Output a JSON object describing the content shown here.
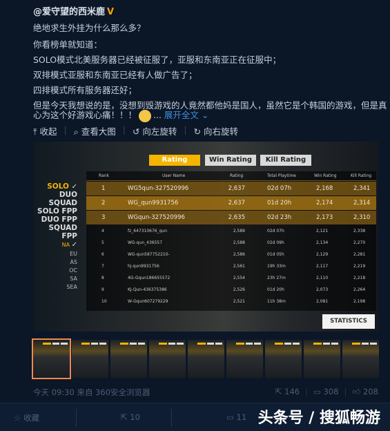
{
  "post": {
    "author": "@爱守望的西米鹿",
    "verified_badge": "V",
    "lines": [
      "绝地求生外挂为什么那么多？",
      "你看榜单就知道：",
      "SOLO模式北美服务器已经被征服了，亚服和东南亚正在征服中；",
      "双排模式亚服和东南亚已经有人做广告了；",
      "四排模式所有服务器还好；",
      "但是今天我想说的是，没想到毁游戏的人竟然都他妈是国人，虽然它是个韩国的游戏，但是真",
      "心为这个好游戏心痛！！！"
    ],
    "ellipsis": "...",
    "expand": "展开全文 ⌄",
    "actions": {
      "collapse": "⤒ 收起",
      "view_large": "⌕ 查看大图",
      "rotate_left": "↺ 向左旋转",
      "rotate_right": "↻ 向右旋转"
    }
  },
  "game": {
    "tabs": [
      "Rating",
      "Win Rating",
      "Kill Rating"
    ],
    "active_tab": 0,
    "modes": [
      "SOLO",
      "DUO",
      "SQUAD",
      "SOLO FPP",
      "DUO FPP",
      "SQUAD FPP"
    ],
    "regions": [
      "NA",
      "EU",
      "AS",
      "OC",
      "SA",
      "SEA"
    ],
    "check": "✓",
    "columns": [
      "Rank",
      "User Name",
      "Rating",
      "Total Playtime",
      "Win Rating",
      "Kill Rating"
    ],
    "rows": [
      [
        "1",
        "WG5qun-327520996",
        "2,637",
        "02d 07h",
        "2,168",
        "2,341"
      ],
      [
        "2",
        "WG_qun9931756",
        "2,637",
        "01d 20h",
        "2,174",
        "2,314"
      ],
      [
        "3",
        "WGqun-327520996",
        "2,635",
        "02d 23h",
        "2,173",
        "2,310"
      ],
      [
        "4",
        "fz_647310676_qun",
        "2,589",
        "02d 07h",
        "2,121",
        "2,338"
      ],
      [
        "5",
        "WG-qun_436557",
        "2,588",
        "02d 09h",
        "2,134",
        "2,270"
      ],
      [
        "6",
        "WG-qun587752210-",
        "2,586",
        "01d 05h",
        "2,129",
        "2,281"
      ],
      [
        "7",
        "hj-qun9931756",
        "2,561",
        "19h 33m",
        "2,117",
        "2,219"
      ],
      [
        "8",
        "4G-Gqun186655572",
        "2,554",
        "23h 27m",
        "2,110",
        "2,218"
      ],
      [
        "9",
        "KJ-Qun-436375386",
        "2,526",
        "01d 20h",
        "2,073",
        "2,264"
      ],
      [
        "10",
        "W-Gqun607279229",
        "2,521",
        "11h 38m",
        "2,081",
        "2,198"
      ]
    ],
    "statistics": "STATISTICS"
  },
  "thumbnails": {
    "count": 9,
    "active": 0
  },
  "footer": {
    "time": "今天 09:30 来自 360安全浏览器",
    "reposts": "146",
    "comments": "308",
    "likes": "208"
  },
  "bottom": {
    "favorite": "☆ 收藏",
    "repost": "⇱ 10",
    "comment": "▭ 11",
    "watermark": "头条号 / 搜狐畅游"
  },
  "colors": {
    "accent": "#f5b400",
    "link": "#3d8fe0",
    "background": "#0b1627"
  }
}
